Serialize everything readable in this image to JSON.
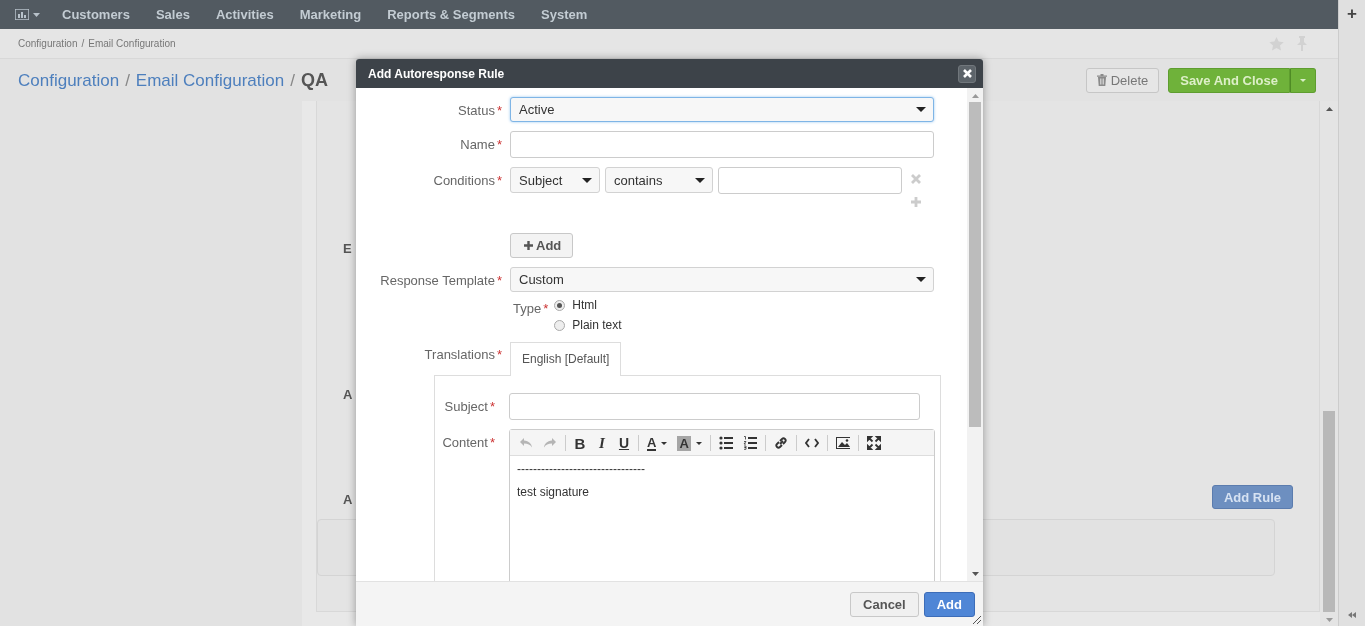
{
  "nav": {
    "items": [
      "Customers",
      "Sales",
      "Activities",
      "Marketing",
      "Reports & Segments",
      "System"
    ]
  },
  "breadcrumb": [
    "Configuration",
    "Email Configuration"
  ],
  "breadcrumb_separator": "/",
  "page_title": {
    "links": [
      "Configuration",
      "Email Configuration"
    ],
    "current": "QA",
    "separator": "/"
  },
  "actions": {
    "delete": "Delete",
    "save": "Save And Close"
  },
  "background_labels": [
    "E",
    "A",
    "A"
  ],
  "add_rule_button": "Add Rule",
  "sidebar_button": "+",
  "modal": {
    "title": "Add Autoresponse Rule",
    "required_mark": "*",
    "status": {
      "label": "Status",
      "value": "Active",
      "focused": true
    },
    "name": {
      "label": "Name"
    },
    "conditions": {
      "label": "Conditions",
      "field": "Subject",
      "operator": "contains",
      "add_label": "Add"
    },
    "response_template": {
      "label": "Response Template",
      "value": "Custom"
    },
    "type": {
      "label": "Type",
      "options": [
        {
          "label": "Html",
          "selected": true
        },
        {
          "label": "Plain text",
          "selected": false
        }
      ]
    },
    "translations": {
      "label": "Translations",
      "tabs": [
        {
          "label": "English [Default]",
          "selected": true
        }
      ]
    },
    "subject": {
      "label": "Subject"
    },
    "content": {
      "label": "Content",
      "toolbar": [
        {
          "kind": "undo",
          "disabled": true
        },
        {
          "kind": "redo",
          "disabled": true
        },
        {
          "kind": "sep"
        },
        {
          "kind": "bold",
          "text": "B"
        },
        {
          "kind": "italic",
          "text": "I"
        },
        {
          "kind": "underline",
          "text": "U"
        },
        {
          "kind": "sep"
        },
        {
          "kind": "textcolor",
          "text": "A"
        },
        {
          "kind": "bgcolor",
          "text": "A"
        },
        {
          "kind": "sep"
        },
        {
          "kind": "bullets"
        },
        {
          "kind": "numbers"
        },
        {
          "kind": "sep"
        },
        {
          "kind": "link"
        },
        {
          "kind": "sep"
        },
        {
          "kind": "code"
        },
        {
          "kind": "sep"
        },
        {
          "kind": "image"
        },
        {
          "kind": "sep"
        },
        {
          "kind": "fullscreen"
        }
      ],
      "lines": [
        "--------------------------------",
        "test signature"
      ]
    },
    "buttons": {
      "cancel": "Cancel",
      "add": "Add"
    }
  }
}
